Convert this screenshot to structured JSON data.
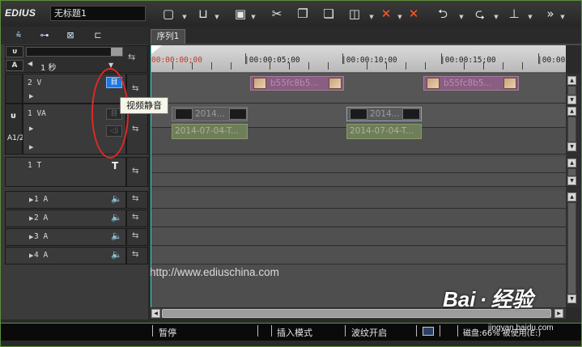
{
  "app": {
    "logo": "EDIUS",
    "project_name": "无标题1"
  },
  "toolbar": {
    "icons": [
      "new-project-icon",
      "open-icon",
      "save-icon",
      "cut-icon",
      "copy-icon",
      "paste-icon",
      "replace-icon",
      "delete-icon",
      "ripple-delete-icon",
      "undo-icon",
      "redo-icon",
      "marker-icon",
      "more-icon"
    ]
  },
  "timeline": {
    "tab_label": "序列1",
    "scale_label": "1 秒",
    "timecodes": [
      "00:00:00;00",
      "|00:00:05;00",
      "|00:00:10;00",
      "|00:00:15;00",
      "|00:00"
    ]
  },
  "tracks": {
    "v2": {
      "name": "2 V"
    },
    "va1": {
      "name": "1 VA",
      "audio_label": "A1/2"
    },
    "t1": {
      "name": "1 T",
      "t_glyph": "T"
    },
    "a1": {
      "name": "1 A"
    },
    "a2": {
      "name": "2 A"
    },
    "a3": {
      "name": "3 A"
    },
    "a4": {
      "name": "4 A"
    }
  },
  "clips": {
    "v2_clip_label": "b55fc8b5...",
    "va_video_label": "2014...",
    "va_audio_label": "2014-07-04-T..."
  },
  "tooltip": {
    "text": "视频静音"
  },
  "watermark": {
    "url": "http://www.ediuschina.com",
    "baidu": "Bai · 经验",
    "baidu_url": "jingyan.baidu.com"
  },
  "status": {
    "pause": "暂停",
    "insert_mode": "插入模式",
    "ripple": "波纹开启",
    "disk": "磁盘:66% 被使用(E:)"
  },
  "colors": {
    "accent_green": "#5c8f3a",
    "clip_purple": "#8a5d83",
    "clip_audio_green": "#6e7e5a",
    "playhead_cyan": "#3fd3c6",
    "annotation_red": "#e12828"
  }
}
